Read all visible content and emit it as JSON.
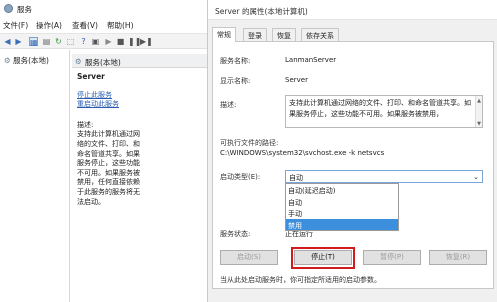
{
  "services_window": {
    "title": "服务",
    "menu": [
      "文件(F)",
      "操作(A)",
      "查看(V)",
      "帮助(H)"
    ],
    "tree_item": "服务(本地)",
    "pane_header": "服务(本地)",
    "service_name": "Server",
    "links": [
      "停止此服务",
      "重启动此服务"
    ],
    "description_label": "描述:",
    "description_text": "支持此计算机通过网络的文件、打印、和命名管道共享。如果服务停止，这些功能不可用。如果服务被禁用，任何直接依赖于此服务的服务将无法启动。"
  },
  "dialog": {
    "title": "Server 的属性(本地计算机)",
    "tabs": [
      "常规",
      "登录",
      "恢复",
      "依存关系"
    ],
    "service_name_label": "服务名称:",
    "service_name_value": "LanmanServer",
    "display_name_label": "显示名称:",
    "display_name_value": "Server",
    "description_label": "描述:",
    "description_value": "支持此计算机通过网络的文件、打印、和命名管道共享。如果服务停止，这些功能不可用。如果服务被禁用，",
    "exe_path_label": "可执行文件的路径:",
    "exe_path_value": "C:\\WINDOWS\\system32\\svchost.exe -k netsvcs",
    "startup_type_label": "启动类型(E):",
    "startup_type_value": "自动",
    "startup_options": [
      "自动(延迟启动)",
      "自动",
      "手动",
      "禁用"
    ],
    "highlighted_option_index": 3,
    "status_label": "服务状态:",
    "status_value": "正在运行",
    "buttons": {
      "start": "启动(S)",
      "stop": "停止(T)",
      "pause": "暂停(P)",
      "resume": "恢复(R)"
    },
    "hint": "当从此处启动服务时，你可指定所适用的启动参数。"
  }
}
